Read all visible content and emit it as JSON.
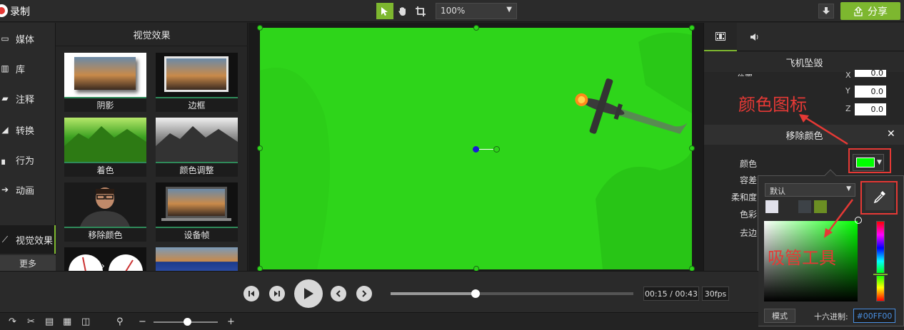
{
  "topbar": {
    "record_label": "录制",
    "zoom_value": "100%",
    "share_label": "分享"
  },
  "leftnav": {
    "items": [
      {
        "label": "媒体",
        "icon": "media-icon"
      },
      {
        "label": "库",
        "icon": "library-icon"
      },
      {
        "label": "注释",
        "icon": "annotation-icon"
      },
      {
        "label": "转换",
        "icon": "transition-icon"
      },
      {
        "label": "行为",
        "icon": "behavior-icon"
      },
      {
        "label": "动画",
        "icon": "animation-icon"
      },
      {
        "label": "视觉效果",
        "icon": "visual-effects-icon"
      }
    ],
    "more_label": "更多"
  },
  "effects": {
    "title": "视觉效果",
    "tiles": [
      {
        "label": "阴影"
      },
      {
        "label": "边框"
      },
      {
        "label": "着色"
      },
      {
        "label": "颜色调整"
      },
      {
        "label": "移除颜色"
      },
      {
        "label": "设备帧"
      }
    ]
  },
  "properties": {
    "clip_title": "飞机坠毁",
    "position_label": "位置:",
    "x_label": "X",
    "x_value": "0.0",
    "y_label": "Y",
    "y_value": "0.0",
    "z_label": "Z",
    "z_value": "0.0",
    "remove_color_title": "移除颜色",
    "color_label": "颜色",
    "tolerance_label": "容差",
    "softness_label": "柔和度",
    "hue_label": "色彩",
    "defringe_label": "去边",
    "selected_color": "#00ff00"
  },
  "annotations": {
    "color_icon_note": "颜色图标",
    "eyedropper_note": "吸管工具"
  },
  "color_popup": {
    "preset_value": "默认",
    "mode_label": "模式",
    "hex_label": "十六进制:",
    "hex_value": "#00FF00",
    "swatch_colors": [
      "#e0e0ea",
      "#3d4247",
      "#6b8e23"
    ]
  },
  "playback": {
    "time": "00:15 / 00:43",
    "fps": "30fps",
    "progress": 0.35
  },
  "colors": {
    "accent": "#7db72f",
    "green_screen": "#2ed51a",
    "annotation_red": "#e53935"
  }
}
